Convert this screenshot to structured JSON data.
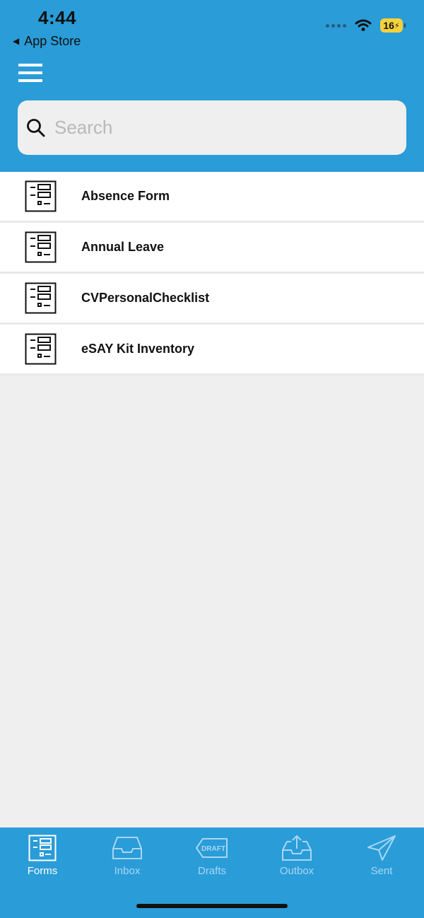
{
  "status_bar": {
    "time": "4:44",
    "back_label": "App Store",
    "battery": "16"
  },
  "search": {
    "placeholder": "Search",
    "value": ""
  },
  "forms": [
    {
      "label": "Absence Form"
    },
    {
      "label": "Annual Leave"
    },
    {
      "label": "CVPersonalChecklist"
    },
    {
      "label": "eSAY Kit Inventory"
    }
  ],
  "tabs": [
    {
      "label": "Forms",
      "icon": "forms-icon",
      "active": true
    },
    {
      "label": "Inbox",
      "icon": "inbox-icon",
      "active": false
    },
    {
      "label": "Drafts",
      "icon": "drafts-icon",
      "active": false
    },
    {
      "label": "Outbox",
      "icon": "outbox-icon",
      "active": false
    },
    {
      "label": "Sent",
      "icon": "sent-icon",
      "active": false
    }
  ],
  "drafts_icon_text": "DRAFT",
  "colors": {
    "accent": "#2a9cd8",
    "background": "#efefef",
    "tab_active": "#ffffff",
    "tab_inactive": "#a9d7f3",
    "battery": "#f5d23b"
  }
}
